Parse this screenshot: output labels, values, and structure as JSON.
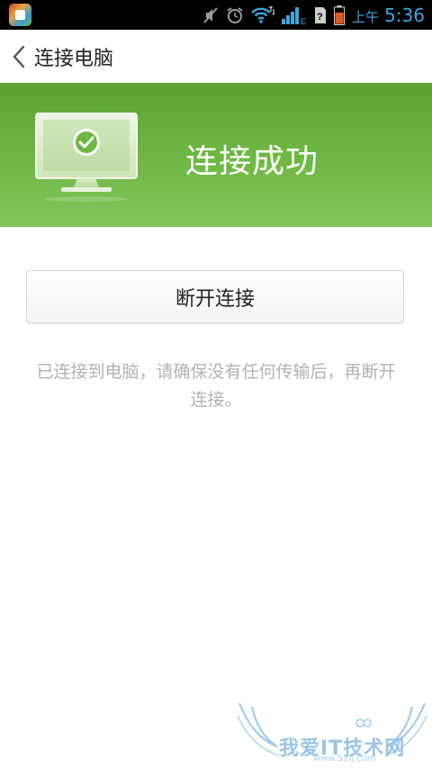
{
  "status_bar": {
    "ampm": "上午",
    "time": "5:36",
    "network_type": "E",
    "accent_color": "#3ba7e0"
  },
  "title_bar": {
    "title": "连接电脑",
    "back_icon": "chevron-left-icon"
  },
  "banner": {
    "status": "连接成功",
    "color": "#6fb844",
    "illustration_icon": "monitor-check-icon"
  },
  "main": {
    "disconnect_label": "断开连接",
    "hint": "已连接到电脑，请确保没有任何传输后，再断开连接。"
  },
  "watermark": {
    "text": "我爱IT技术网",
    "url": "www.52ij.com"
  }
}
